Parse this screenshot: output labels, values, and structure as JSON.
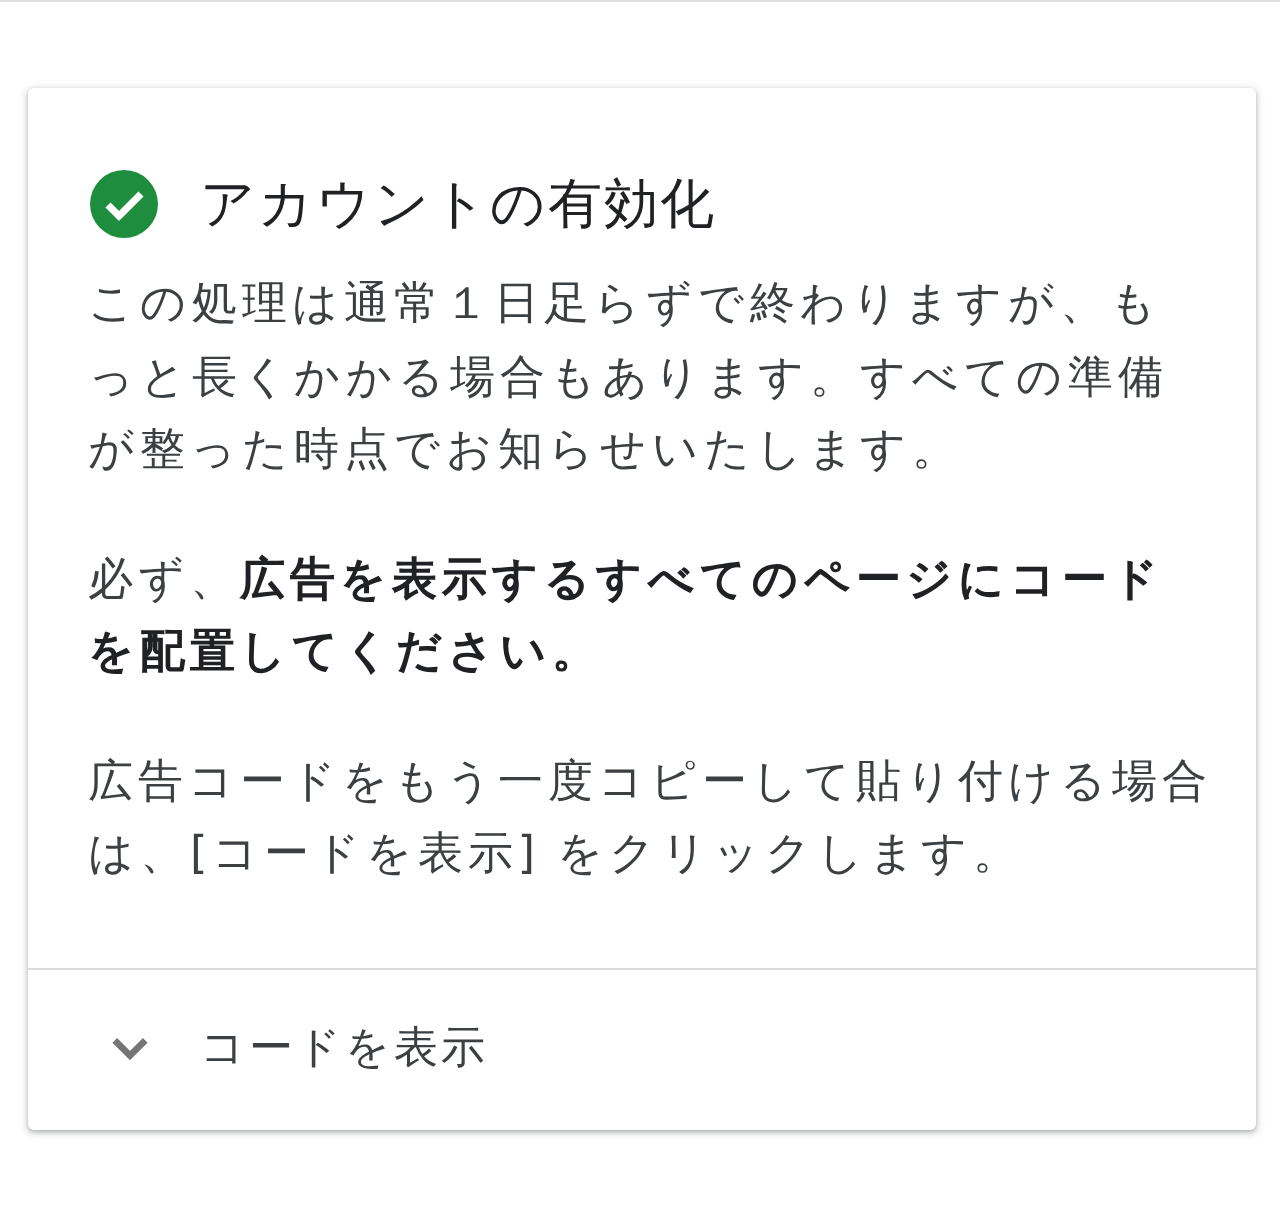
{
  "card": {
    "title": "アカウントの有効化",
    "done": true,
    "paragraphs": [
      "この処理は通常１日足らずで終わりますが、もっと長くかかる場合もあります。すべての準備が整った時点でお知らせいたします。",
      "必ず、**広告を表示するすべてのページにコードを配置してください。**",
      "広告コードをもう一度コピーして貼り付ける場合は、[コードを表示] をクリックします。"
    ],
    "footer": {
      "label": "コードを表示",
      "expanded": false
    }
  }
}
